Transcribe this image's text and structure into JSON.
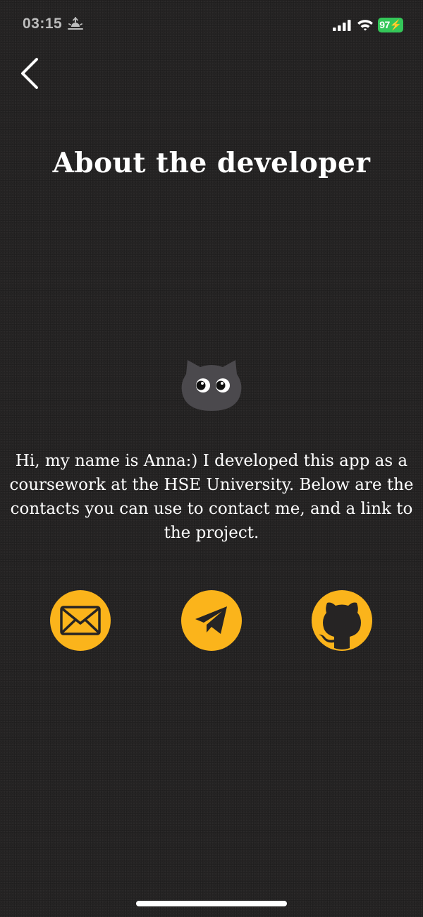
{
  "status_bar": {
    "time": "03:15",
    "battery": "97",
    "icons": [
      "sunrise-icon",
      "signal-icon",
      "wifi-icon",
      "battery-icon"
    ]
  },
  "header": {
    "back_icon": "chevron-left-icon",
    "title": "About the developer"
  },
  "avatar": {
    "icon": "cat-face-icon"
  },
  "bio": {
    "text": "Hi, my name is Anna:) I developed this app as a coursework at the HSE University. Below are the contacts you can use to contact me, and a link to the project."
  },
  "contacts": [
    {
      "icon": "envelope-icon"
    },
    {
      "icon": "telegram-icon"
    },
    {
      "icon": "github-icon"
    }
  ],
  "colors": {
    "background": "#262424",
    "accent": "#fbb41b",
    "battery": "#34c759",
    "avatar": "#4b494d"
  }
}
